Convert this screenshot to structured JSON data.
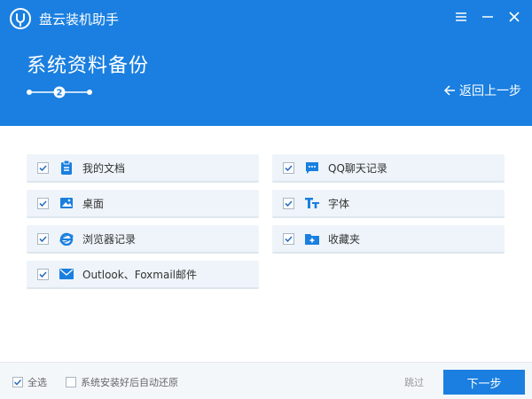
{
  "app": {
    "title": "盘云装机助手"
  },
  "window_controls": {
    "menu": "menu-icon",
    "minimize": "minimize-icon",
    "close": "close-icon"
  },
  "header": {
    "page_title": "系统资料备份",
    "current_step": "2",
    "back_label": "返回上一步"
  },
  "items": [
    {
      "label": "我的文档",
      "icon": "document-icon",
      "checked": true
    },
    {
      "label": "桌面",
      "icon": "desktop-icon",
      "checked": true
    },
    {
      "label": "浏览器记录",
      "icon": "ie-browser-icon",
      "checked": true
    },
    {
      "label": "Outlook、Foxmail邮件",
      "icon": "mail-icon",
      "checked": true
    },
    {
      "label": "QQ聊天记录",
      "icon": "chat-icon",
      "checked": true
    },
    {
      "label": "字体",
      "icon": "font-icon",
      "checked": true
    },
    {
      "label": "收藏夹",
      "icon": "favorites-folder-icon",
      "checked": true
    }
  ],
  "footer": {
    "select_all_label": "全选",
    "select_all_checked": true,
    "auto_restore_label": "系统安装好后自动还原",
    "auto_restore_checked": false,
    "skip_label": "跳过",
    "next_label": "下一步"
  },
  "colors": {
    "primary": "#1a7fe0",
    "item_bg": "#eef4f9",
    "icon_blue": "#1a7fe0"
  }
}
